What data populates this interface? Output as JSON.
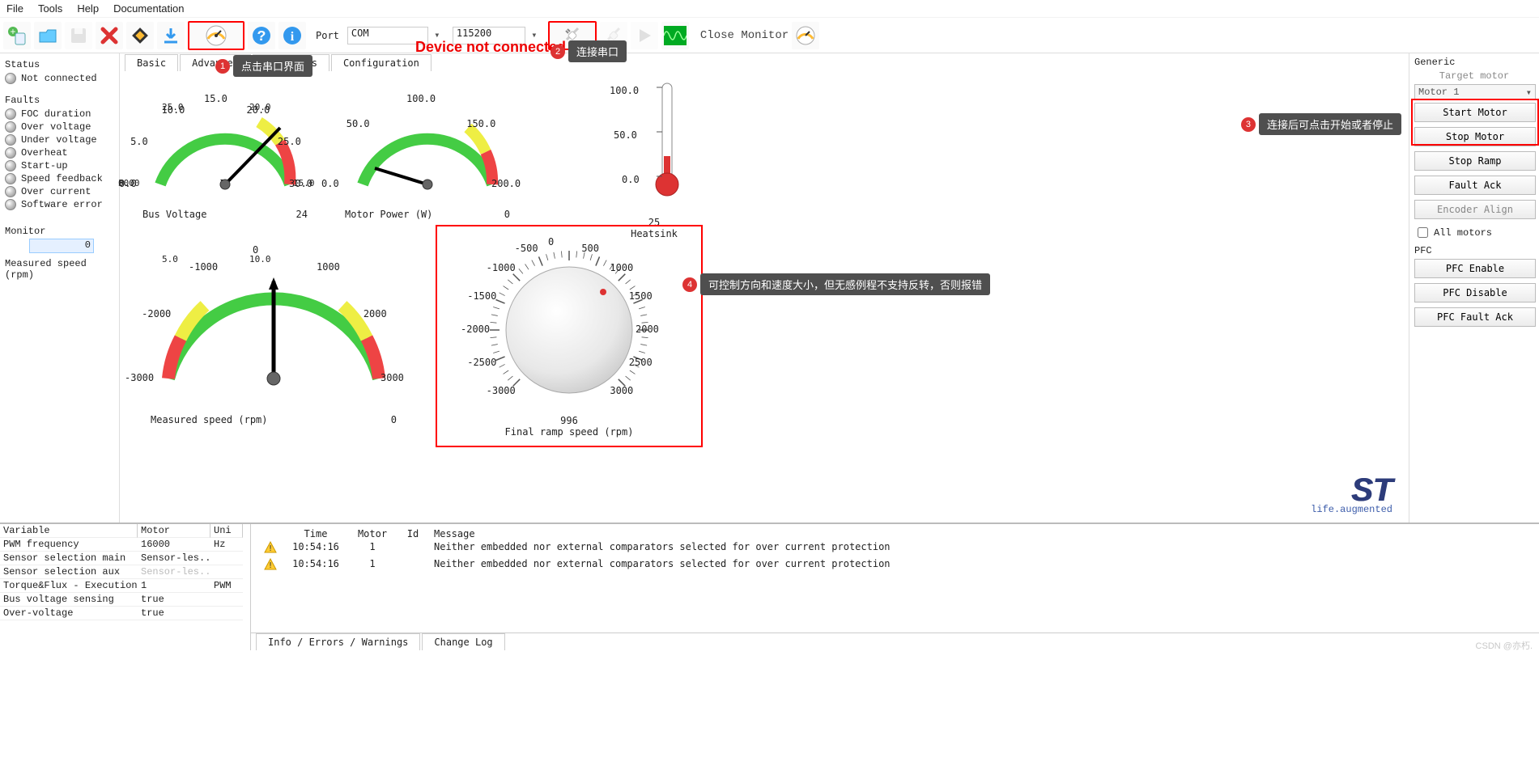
{
  "menu": {
    "file": "File",
    "tools": "Tools",
    "help": "Help",
    "doc": "Documentation"
  },
  "toolbar": {
    "port_label": "Port",
    "port_value": "COM",
    "baud_value": "115200",
    "close_monitor": "Close Monitor"
  },
  "status": {
    "title": "Status",
    "not_connected": "Not connected"
  },
  "faults": {
    "title": "Faults",
    "items": [
      "FOC duration",
      "Over voltage",
      "Under voltage",
      "Overheat",
      "Start-up",
      "Speed feedback",
      "Over current",
      "Software error"
    ]
  },
  "monitor_panel": {
    "title": "Monitor",
    "value": "0",
    "label": "Measured speed (rpm)"
  },
  "tabs": [
    "Basic",
    "Advanced",
    "Registers",
    "Configuration"
  ],
  "gauges": {
    "bus_voltage": {
      "label": "Bus Voltage",
      "value": "24",
      "ticks": [
        "0.0",
        "5.0",
        "10.0",
        "15.0",
        "20.0",
        "25.0",
        "30.0"
      ]
    },
    "motor_power": {
      "label": "Motor Power (W)",
      "value": "0",
      "ticks": [
        "0.0",
        "50.0",
        "100.0",
        "150.0",
        "200.0"
      ]
    },
    "measured_speed": {
      "label": "Measured speed (rpm)",
      "value": "0",
      "ticks": [
        "-3000",
        "-2000",
        "-1000",
        "0",
        "1000",
        "2000",
        "3000"
      ]
    },
    "final_ramp": {
      "label": "Final ramp speed (rpm)",
      "value": "996",
      "ticks": [
        "-3000",
        "-2500",
        "-2000",
        "-1500",
        "-1000",
        "-500",
        "0",
        "500",
        "1000",
        "1500",
        "2000",
        "2500",
        "3000"
      ]
    },
    "heatsink": {
      "label": "Heatsink",
      "value": "25",
      "ticks": [
        "0.0",
        "50.0",
        "100.0"
      ]
    }
  },
  "right": {
    "generic_title": "Generic",
    "target_motor": "Target motor",
    "motor_sel": "Motor 1",
    "start": "Start Motor",
    "stop": "Stop Motor",
    "stop_ramp": "Stop Ramp",
    "fault_ack": "Fault Ack",
    "encoder_align": "Encoder Align",
    "all_motors": "All motors",
    "pfc_title": "PFC",
    "pfc_enable": "PFC Enable",
    "pfc_disable": "PFC Disable",
    "pfc_fault_ack": "PFC Fault Ack"
  },
  "annotations": {
    "dnc": "Device not connected",
    "a1": "点击串口界面",
    "a2": "连接串口",
    "a3": "连接后可点击开始或者停止",
    "a4": "可控制方向和速度大小，但无感例程不支持反转，否则报错"
  },
  "stlogo": {
    "brand": "ST",
    "tag": "life.augmented"
  },
  "vars": {
    "headers": [
      "Variable",
      "Motor",
      "Uni"
    ],
    "rows": [
      {
        "v": "PWM frequency",
        "m": "16000",
        "u": "Hz",
        "dim": false
      },
      {
        "v": "Sensor selection main",
        "m": "Sensor-les...",
        "u": "",
        "dim": false
      },
      {
        "v": "Sensor selection aux",
        "m": "Sensor-les...",
        "u": "",
        "dim": true
      },
      {
        "v": "Torque&Flux - Execution ...",
        "m": "1",
        "u": "PWM",
        "dim": false
      },
      {
        "v": "Bus voltage sensing",
        "m": "true",
        "u": "",
        "dim": false
      },
      {
        "v": "Over-voltage",
        "m": "true",
        "u": "",
        "dim": false
      }
    ]
  },
  "log": {
    "headers": [
      "Time",
      "Motor",
      "Id",
      "Message"
    ],
    "rows": [
      {
        "time": "10:54:16",
        "motor": "1",
        "id": "",
        "msg": "Neither embedded nor external comparators selected for over current protection"
      },
      {
        "time": "10:54:16",
        "motor": "1",
        "id": "",
        "msg": "Neither embedded nor external comparators selected for over current protection"
      }
    ],
    "tabs": [
      "Info / Errors / Warnings",
      "Change Log"
    ]
  },
  "watermark": "CSDN @亦朽."
}
